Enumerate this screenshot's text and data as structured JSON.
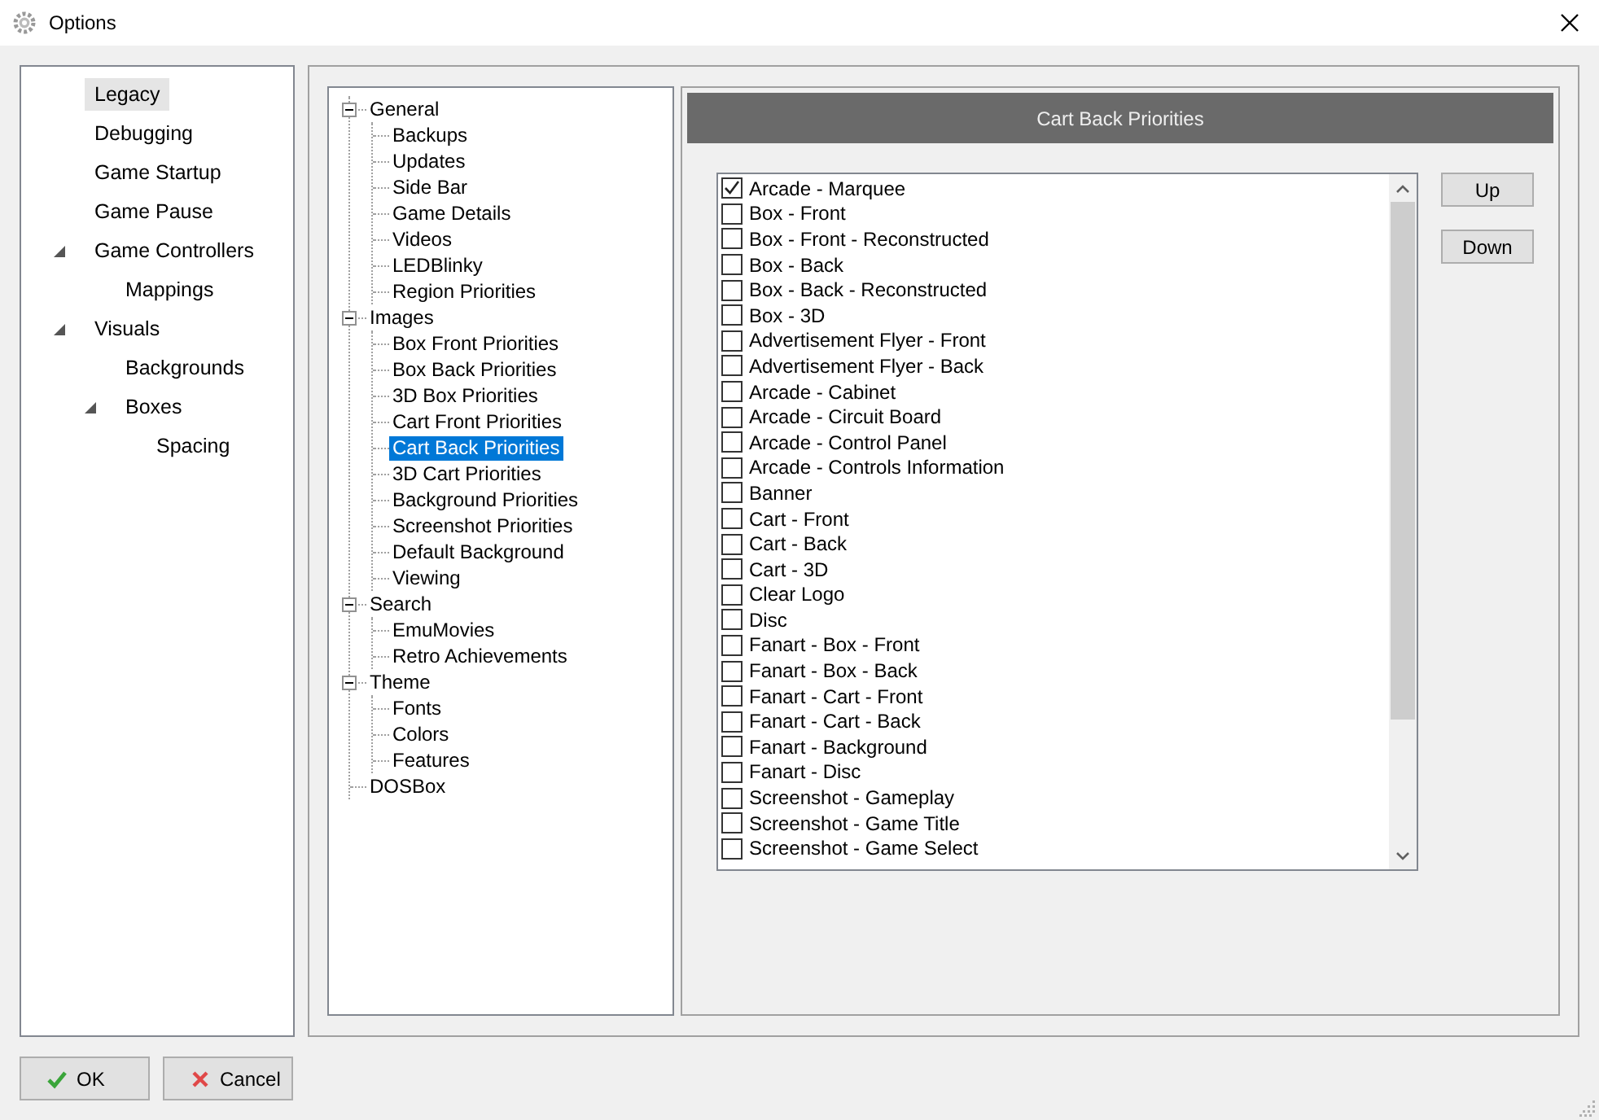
{
  "window": {
    "title": "Options"
  },
  "nav": {
    "items": [
      {
        "label": "Legacy",
        "selected": true
      },
      {
        "label": "Debugging",
        "selected": false
      },
      {
        "label": "Game Startup",
        "selected": false
      },
      {
        "label": "Game Pause",
        "selected": false
      },
      {
        "label": "Game Controllers",
        "selected": false,
        "expanded": true,
        "children": [
          {
            "label": "Mappings",
            "selected": false
          }
        ]
      },
      {
        "label": "Visuals",
        "selected": false,
        "expanded": true,
        "children": [
          {
            "label": "Backgrounds",
            "selected": false
          },
          {
            "label": "Boxes",
            "selected": false,
            "expanded": true,
            "children": [
              {
                "label": "Spacing",
                "selected": false
              }
            ]
          }
        ]
      }
    ]
  },
  "tree": {
    "items": [
      {
        "label": "General",
        "selected": false,
        "expanded": true,
        "children": [
          {
            "label": "Backups",
            "selected": false
          },
          {
            "label": "Updates",
            "selected": false
          },
          {
            "label": "Side Bar",
            "selected": false
          },
          {
            "label": "Game Details",
            "selected": false
          },
          {
            "label": "Videos",
            "selected": false
          },
          {
            "label": "LEDBlinky",
            "selected": false
          },
          {
            "label": "Region Priorities",
            "selected": false
          }
        ]
      },
      {
        "label": "Images",
        "selected": false,
        "expanded": true,
        "children": [
          {
            "label": "Box Front Priorities",
            "selected": false
          },
          {
            "label": "Box Back Priorities",
            "selected": false
          },
          {
            "label": "3D Box Priorities",
            "selected": false
          },
          {
            "label": "Cart Front Priorities",
            "selected": false
          },
          {
            "label": "Cart Back Priorities",
            "selected": true
          },
          {
            "label": "3D Cart Priorities",
            "selected": false
          },
          {
            "label": "Background Priorities",
            "selected": false
          },
          {
            "label": "Screenshot Priorities",
            "selected": false
          },
          {
            "label": "Default Background",
            "selected": false
          },
          {
            "label": "Viewing",
            "selected": false
          }
        ]
      },
      {
        "label": "Search",
        "selected": false,
        "expanded": true,
        "children": [
          {
            "label": "EmuMovies",
            "selected": false
          },
          {
            "label": "Retro Achievements",
            "selected": false
          }
        ]
      },
      {
        "label": "Theme",
        "selected": false,
        "expanded": true,
        "children": [
          {
            "label": "Fonts",
            "selected": false
          },
          {
            "label": "Colors",
            "selected": false
          },
          {
            "label": "Features",
            "selected": false
          }
        ]
      },
      {
        "label": "DOSBox",
        "selected": false
      }
    ]
  },
  "panel": {
    "header": "Cart Back Priorities",
    "list": [
      {
        "label": "Arcade - Marquee",
        "checked": true
      },
      {
        "label": "Box - Front",
        "checked": false
      },
      {
        "label": "Box - Front - Reconstructed",
        "checked": false
      },
      {
        "label": "Box - Back",
        "checked": false
      },
      {
        "label": "Box - Back - Reconstructed",
        "checked": false
      },
      {
        "label": "Box - 3D",
        "checked": false
      },
      {
        "label": "Advertisement Flyer - Front",
        "checked": false
      },
      {
        "label": "Advertisement Flyer - Back",
        "checked": false
      },
      {
        "label": "Arcade - Cabinet",
        "checked": false
      },
      {
        "label": "Arcade - Circuit Board",
        "checked": false
      },
      {
        "label": "Arcade - Control Panel",
        "checked": false
      },
      {
        "label": "Arcade - Controls Information",
        "checked": false
      },
      {
        "label": "Banner",
        "checked": false
      },
      {
        "label": "Cart - Front",
        "checked": false
      },
      {
        "label": "Cart - Back",
        "checked": false
      },
      {
        "label": "Cart - 3D",
        "checked": false
      },
      {
        "label": "Clear Logo",
        "checked": false
      },
      {
        "label": "Disc",
        "checked": false
      },
      {
        "label": "Fanart - Box - Front",
        "checked": false
      },
      {
        "label": "Fanart - Box - Back",
        "checked": false
      },
      {
        "label": "Fanart - Cart - Front",
        "checked": false
      },
      {
        "label": "Fanart - Cart - Back",
        "checked": false
      },
      {
        "label": "Fanart - Background",
        "checked": false
      },
      {
        "label": "Fanart - Disc",
        "checked": false
      },
      {
        "label": "Screenshot - Gameplay",
        "checked": false
      },
      {
        "label": "Screenshot - Game Title",
        "checked": false
      },
      {
        "label": "Screenshot - Game Select",
        "checked": false
      }
    ],
    "buttons": [
      "Up",
      "Down"
    ]
  },
  "footer": {
    "buttons": [
      {
        "label": "OK",
        "kind": "ok"
      },
      {
        "label": "Cancel",
        "kind": "cancel"
      }
    ]
  }
}
